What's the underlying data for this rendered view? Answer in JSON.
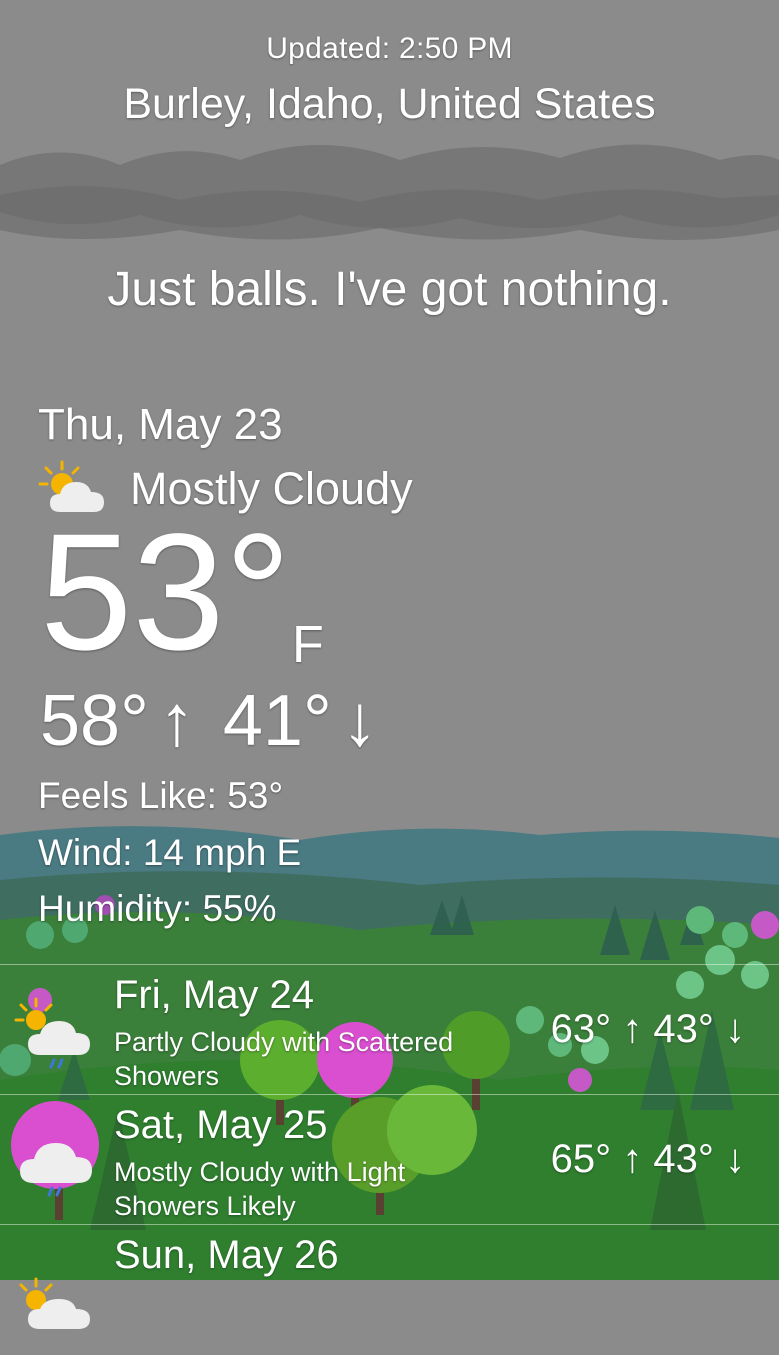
{
  "header": {
    "updated": "Updated: 2:50 PM",
    "location": "Burley, Idaho, United States",
    "tagline": "Just balls. I've got nothing."
  },
  "current": {
    "date": "Thu, May 23",
    "condition": "Mostly Cloudy",
    "condition_icon": "sun-behind-cloud-icon",
    "temperature": "53°",
    "unit": "F",
    "high": "58°",
    "low": "41°",
    "up_arrow": "↑",
    "down_arrow": "↓",
    "feels_like": "Feels Like: 53°",
    "wind": "Wind: 14 mph E",
    "humidity": "Humidity: 55%"
  },
  "forecast": [
    {
      "date": "Fri, May 24",
      "summary": "Partly Cloudy with Scattered Showers",
      "high_low": "63° ↑ 43° ↓",
      "icon": "partly-cloudy-showers-icon"
    },
    {
      "date": "Sat, May 25",
      "summary": "Mostly Cloudy with Light Showers Likely",
      "high_low": "65° ↑ 43° ↓",
      "icon": "cloudy-light-showers-icon"
    },
    {
      "date": "Sun, May 26",
      "summary": "",
      "high_low": "",
      "icon": "sun-behind-cloud-icon"
    }
  ],
  "colors": {
    "sky": "#8b8b8b",
    "cloud_band": "#747474",
    "hill_blue": "#4a7a82",
    "grass": "#2f7f2f",
    "tree_pink": "#d94fd0",
    "tree_green": "#5cae2e"
  }
}
